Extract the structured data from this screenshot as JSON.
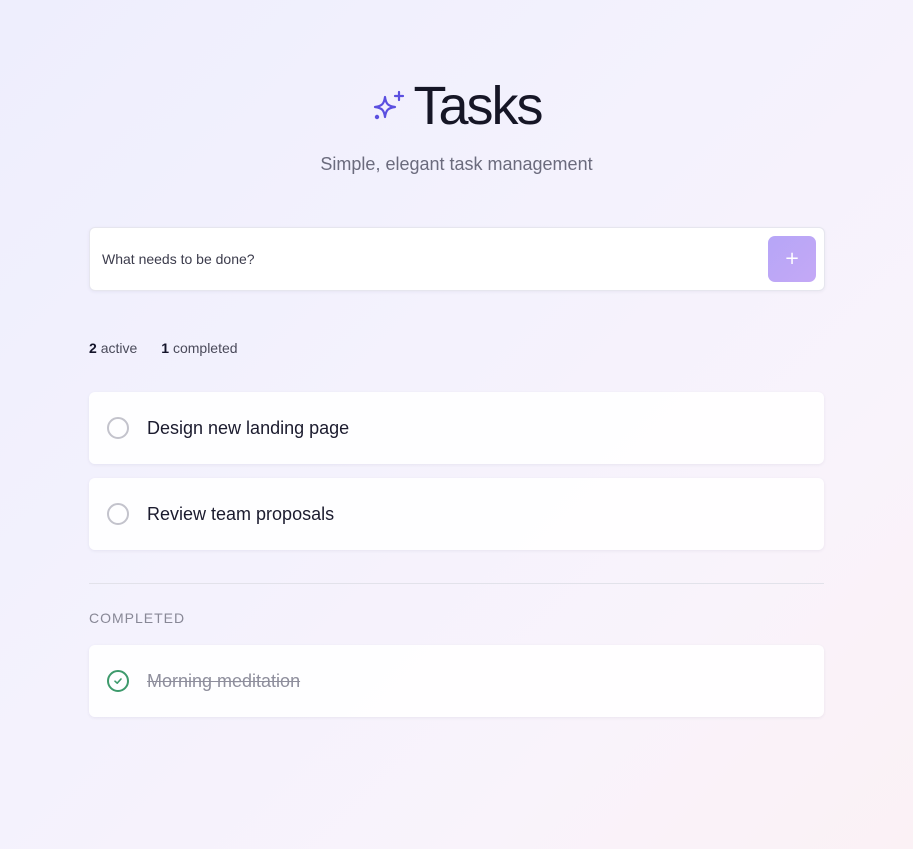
{
  "header": {
    "title": "Tasks",
    "subtitle": "Simple, elegant task management",
    "icon": "sparkles-icon",
    "accent_color": "#5b4fe0"
  },
  "new_task": {
    "placeholder": "What needs to be done?",
    "value": "",
    "add_label": "+"
  },
  "stats": {
    "active_count": "2",
    "active_label": "active",
    "completed_count": "1",
    "completed_label": "completed"
  },
  "active_tasks": [
    {
      "text": "Design new landing page",
      "completed": false
    },
    {
      "text": "Review team proposals",
      "completed": false
    }
  ],
  "completed_section": {
    "label": "COMPLETED",
    "tasks": [
      {
        "text": "Morning meditation",
        "completed": true
      }
    ]
  },
  "colors": {
    "done_check": "#3d9a6c",
    "add_button": "#bda7f7"
  }
}
